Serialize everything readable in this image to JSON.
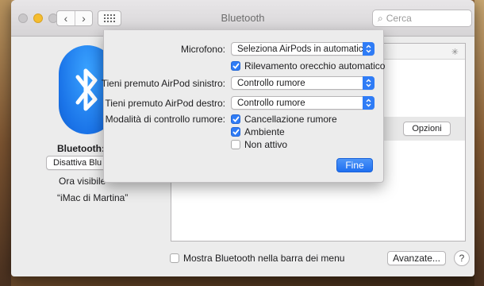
{
  "window": {
    "title": "Bluetooth"
  },
  "search": {
    "placeholder": "Cerca"
  },
  "bluetooth": {
    "status_label": "Bluetooth: a",
    "disable_button": "Disattiva Blu",
    "visible_text": "Ora visibile",
    "device_name": "“iMac di Martina”"
  },
  "devices": {
    "options_button": "Opzioni"
  },
  "footer": {
    "show_in_menubar_label": "Mostra Bluetooth nella barra dei menu",
    "show_in_menubar_checked": false,
    "advanced_button": "Avanzate...",
    "help_button": "?"
  },
  "sheet": {
    "microphone_label": "Microfono:",
    "microphone_value": "Seleziona AirPods in automatico",
    "ear_detection_label": "Rilevamento orecchio automatico",
    "ear_detection_checked": true,
    "left_label": "Tieni premuto AirPod sinistro:",
    "left_value": "Controllo rumore",
    "right_label": "Tieni premuto AirPod destro:",
    "right_value": "Controllo rumore",
    "noise_modes_label": "Modalità di controllo rumore:",
    "modes": [
      {
        "label": "Cancellazione rumore",
        "checked": true
      },
      {
        "label": "Ambiente",
        "checked": true
      },
      {
        "label": "Non attivo",
        "checked": false
      }
    ],
    "done_button": "Fine"
  },
  "colors": {
    "accent": "#2f7cf6",
    "bluetooth_blue": "#1a73e8"
  }
}
